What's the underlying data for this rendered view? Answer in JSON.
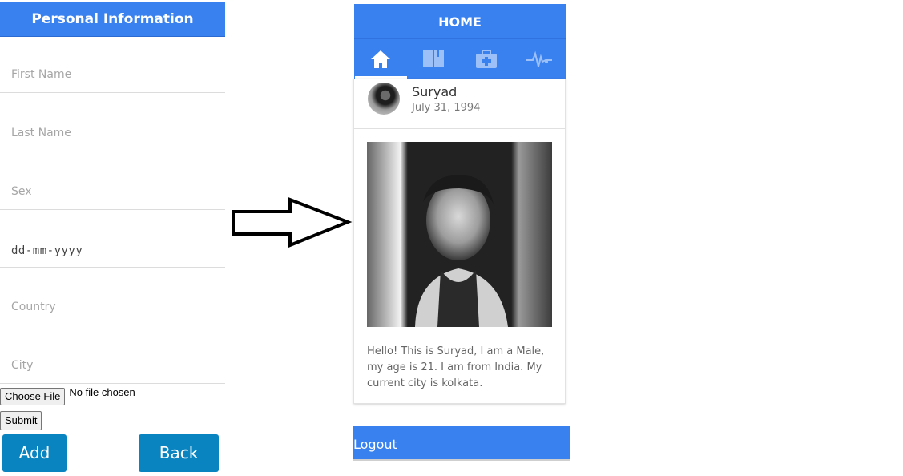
{
  "form": {
    "title": "Personal Information",
    "fields": [
      {
        "placeholder": "First Name"
      },
      {
        "placeholder": "Last Name"
      },
      {
        "placeholder": "Sex"
      },
      {
        "placeholder": "dd-mm-yyyy"
      },
      {
        "placeholder": "Country"
      },
      {
        "placeholder": "City"
      }
    ],
    "file_button": "Choose File",
    "file_status": "No file chosen",
    "submit_label": "Submit",
    "add_label": "Add",
    "back_label": "Back"
  },
  "arrow": {
    "icon": "right-arrow-icon"
  },
  "phone": {
    "header_title": "HOME",
    "tabs": [
      {
        "icon": "home-icon",
        "active": true
      },
      {
        "icon": "book-icon",
        "active": false
      },
      {
        "icon": "medical-kit-icon",
        "active": false
      },
      {
        "icon": "heartbeat-icon",
        "active": false
      }
    ],
    "profile": {
      "name": "Suryad",
      "dob": "July 31, 1994",
      "bio": "Hello! This is Suryad, I am a Male, my age is 21. I am from India. My current city is kolkata."
    },
    "logout_label": "Logout"
  },
  "colors": {
    "primary": "#3a81f0",
    "button_blue": "#0a84c1"
  }
}
